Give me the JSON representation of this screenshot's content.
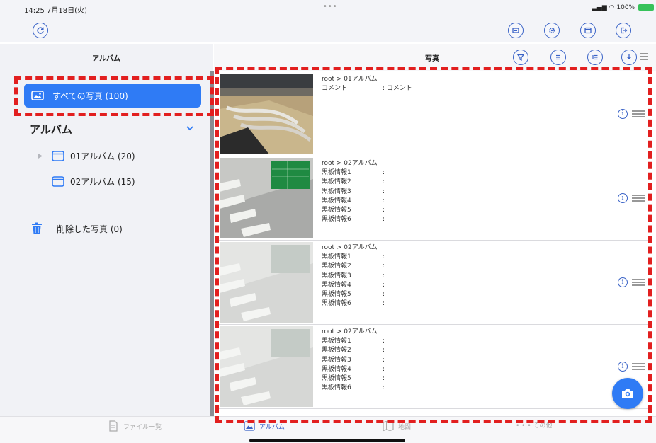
{
  "status_bar": {
    "time": "14:25  7月18日(火)",
    "dots": "•••",
    "battery": "100%"
  },
  "toolbar": {
    "left_icons": [
      "refresh-icon"
    ],
    "right_icons": [
      "photo-frame-icon",
      "gear-icon",
      "window-icon",
      "export-icon"
    ]
  },
  "left_panel": {
    "title": "アルバム",
    "all_photos_label": "すべての写真 (100)",
    "album_section_label": "アルバム",
    "albums": [
      {
        "label": "01アルバム (20)",
        "expandable": true
      },
      {
        "label": "02アルバム (15)",
        "expandable": false
      }
    ],
    "deleted_label": "削除した写真 (0)"
  },
  "right_panel": {
    "title": "写真",
    "header_icons": [
      "filter-icon",
      "list-icon",
      "sort-list-icon",
      "download-menu-icon"
    ],
    "rows": [
      {
        "path": "root > 01アルバム",
        "fields": [
          {
            "key": "コメント",
            "value": ": コメント"
          }
        ]
      },
      {
        "path": "root > 02アルバム",
        "fields": [
          {
            "key": "黒板情報1",
            "value": ":"
          },
          {
            "key": "黒板情報2",
            "value": ":"
          },
          {
            "key": "黒板情報3",
            "value": ":"
          },
          {
            "key": "黒板情報4",
            "value": ":"
          },
          {
            "key": "黒板情報5",
            "value": ":"
          },
          {
            "key": "黒板情報6",
            "value": ":"
          }
        ]
      },
      {
        "path": "root > 02アルバム",
        "fields": [
          {
            "key": "黒板情報1",
            "value": ":"
          },
          {
            "key": "黒板情報2",
            "value": ":"
          },
          {
            "key": "黒板情報3",
            "value": ":"
          },
          {
            "key": "黒板情報4",
            "value": ":"
          },
          {
            "key": "黒板情報5",
            "value": ":"
          },
          {
            "key": "黒板情報6",
            "value": ":"
          }
        ]
      },
      {
        "path": "root > 02アルバム",
        "fields": [
          {
            "key": "黒板情報1",
            "value": ":"
          },
          {
            "key": "黒板情報2",
            "value": ":"
          },
          {
            "key": "黒板情報3",
            "value": ":"
          },
          {
            "key": "黒板情報4",
            "value": ":"
          },
          {
            "key": "黒板情報5",
            "value": ":"
          },
          {
            "key": "黒板情報6",
            "value": ":"
          }
        ]
      }
    ]
  },
  "tab_bar": {
    "tabs": [
      {
        "label": "ファイル一覧",
        "icon": "document-icon",
        "active": false
      },
      {
        "label": "アルバム",
        "icon": "photo-icon",
        "active": true
      },
      {
        "label": "地図",
        "icon": "map-icon",
        "active": false
      },
      {
        "label": "• • • その他",
        "icon": "",
        "active": false
      }
    ]
  },
  "colors": {
    "accent": "#2f7bf5",
    "highlight_dash": "#e21f1f",
    "sidebar_bg": "#f1f2f6"
  }
}
